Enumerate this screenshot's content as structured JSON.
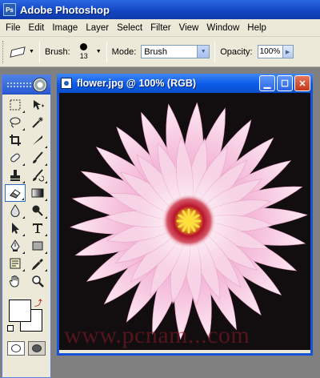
{
  "app": {
    "title": "Adobe Photoshop",
    "logo_icon": "photoshop-logo-icon"
  },
  "menubar": {
    "items": [
      "File",
      "Edit",
      "Image",
      "Layer",
      "Select",
      "Filter",
      "View",
      "Window",
      "Help"
    ]
  },
  "options": {
    "tool_icon": "eraser-icon",
    "brush_label": "Brush:",
    "brush_size": "13",
    "mode_label": "Mode:",
    "mode_value": "Brush",
    "opacity_label": "Opacity:",
    "opacity_value": "100%"
  },
  "toolbox": {
    "tools": [
      [
        "marquee-icon",
        "move-icon"
      ],
      [
        "lasso-icon",
        "magic-wand-icon"
      ],
      [
        "crop-icon",
        "slice-icon"
      ],
      [
        "healing-brush-icon",
        "brush-icon"
      ],
      [
        "clone-stamp-icon",
        "history-brush-icon"
      ],
      [
        "eraser-icon",
        "gradient-icon"
      ],
      [
        "blur-icon",
        "dodge-icon"
      ],
      [
        "path-selection-icon",
        "type-icon"
      ],
      [
        "pen-icon",
        "shape-icon"
      ],
      [
        "notes-icon",
        "eyedropper-icon"
      ],
      [
        "hand-icon",
        "zoom-icon"
      ]
    ],
    "active_tool": "eraser-icon",
    "foreground_color": "#ffffff",
    "background_color": "#ffffff"
  },
  "document": {
    "title": "flower.jpg @ 100% (RGB)",
    "watermark": "www.pcnam...com",
    "canvas_background": "#120d0e",
    "petal_color": "#f5c6df",
    "center_color": "#c0152b",
    "stamen_color": "#ffe03a"
  }
}
